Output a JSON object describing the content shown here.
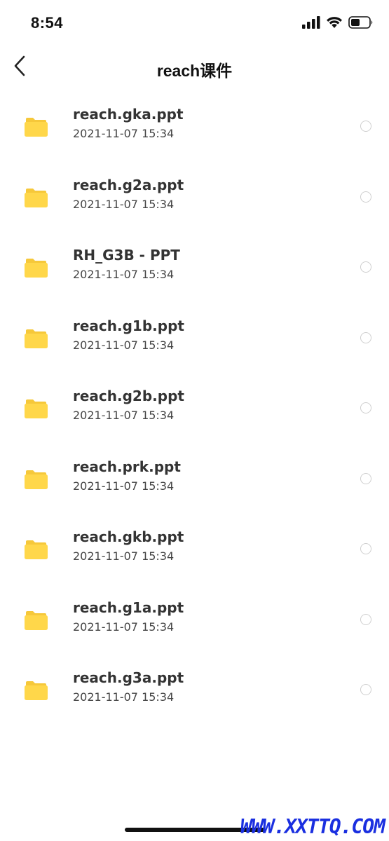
{
  "status_bar": {
    "time": "8:54",
    "icons": [
      "cellular-signal-icon",
      "wifi-icon",
      "battery-icon"
    ]
  },
  "nav": {
    "title": "reach课件",
    "back_icon": "chevron-left-icon"
  },
  "files": [
    {
      "name": "reach.gka.ppt",
      "time": "2021-11-07 15:34"
    },
    {
      "name": "reach.g2a.ppt",
      "time": "2021-11-07 15:34"
    },
    {
      "name": "RH_G3B - PPT",
      "time": "2021-11-07 15:34"
    },
    {
      "name": "reach.g1b.ppt",
      "time": "2021-11-07 15:34"
    },
    {
      "name": "reach.g2b.ppt",
      "time": "2021-11-07 15:34"
    },
    {
      "name": "reach.prk.ppt",
      "time": "2021-11-07 15:34"
    },
    {
      "name": "reach.gkb.ppt",
      "time": "2021-11-07 15:34"
    },
    {
      "name": "reach.g1a.ppt",
      "time": "2021-11-07 15:34"
    },
    {
      "name": "reach.g3a.ppt",
      "time": "2021-11-07 15:34"
    }
  ],
  "watermark": "WWW.XXTTQ.COM",
  "colors": {
    "folder": "#FFD74A",
    "folder_tab": "#F6C83A",
    "radio_border": "#CFCFCF",
    "watermark": "#1A2FE0"
  }
}
